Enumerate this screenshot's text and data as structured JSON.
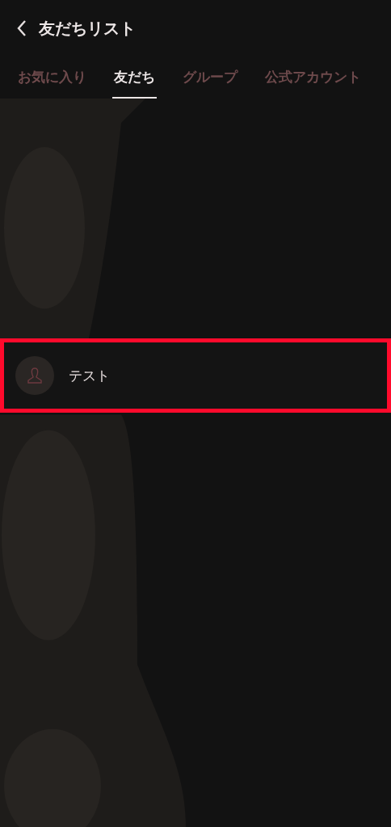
{
  "header": {
    "title": "友だちリスト"
  },
  "tabs": [
    {
      "label": "お気に入り",
      "selected": false
    },
    {
      "label": "友だち",
      "selected": true
    },
    {
      "label": "グループ",
      "selected": false
    },
    {
      "label": "公式アカウント",
      "selected": false
    }
  ],
  "friends": [
    {
      "name": "テスト",
      "highlighted": true
    }
  ]
}
